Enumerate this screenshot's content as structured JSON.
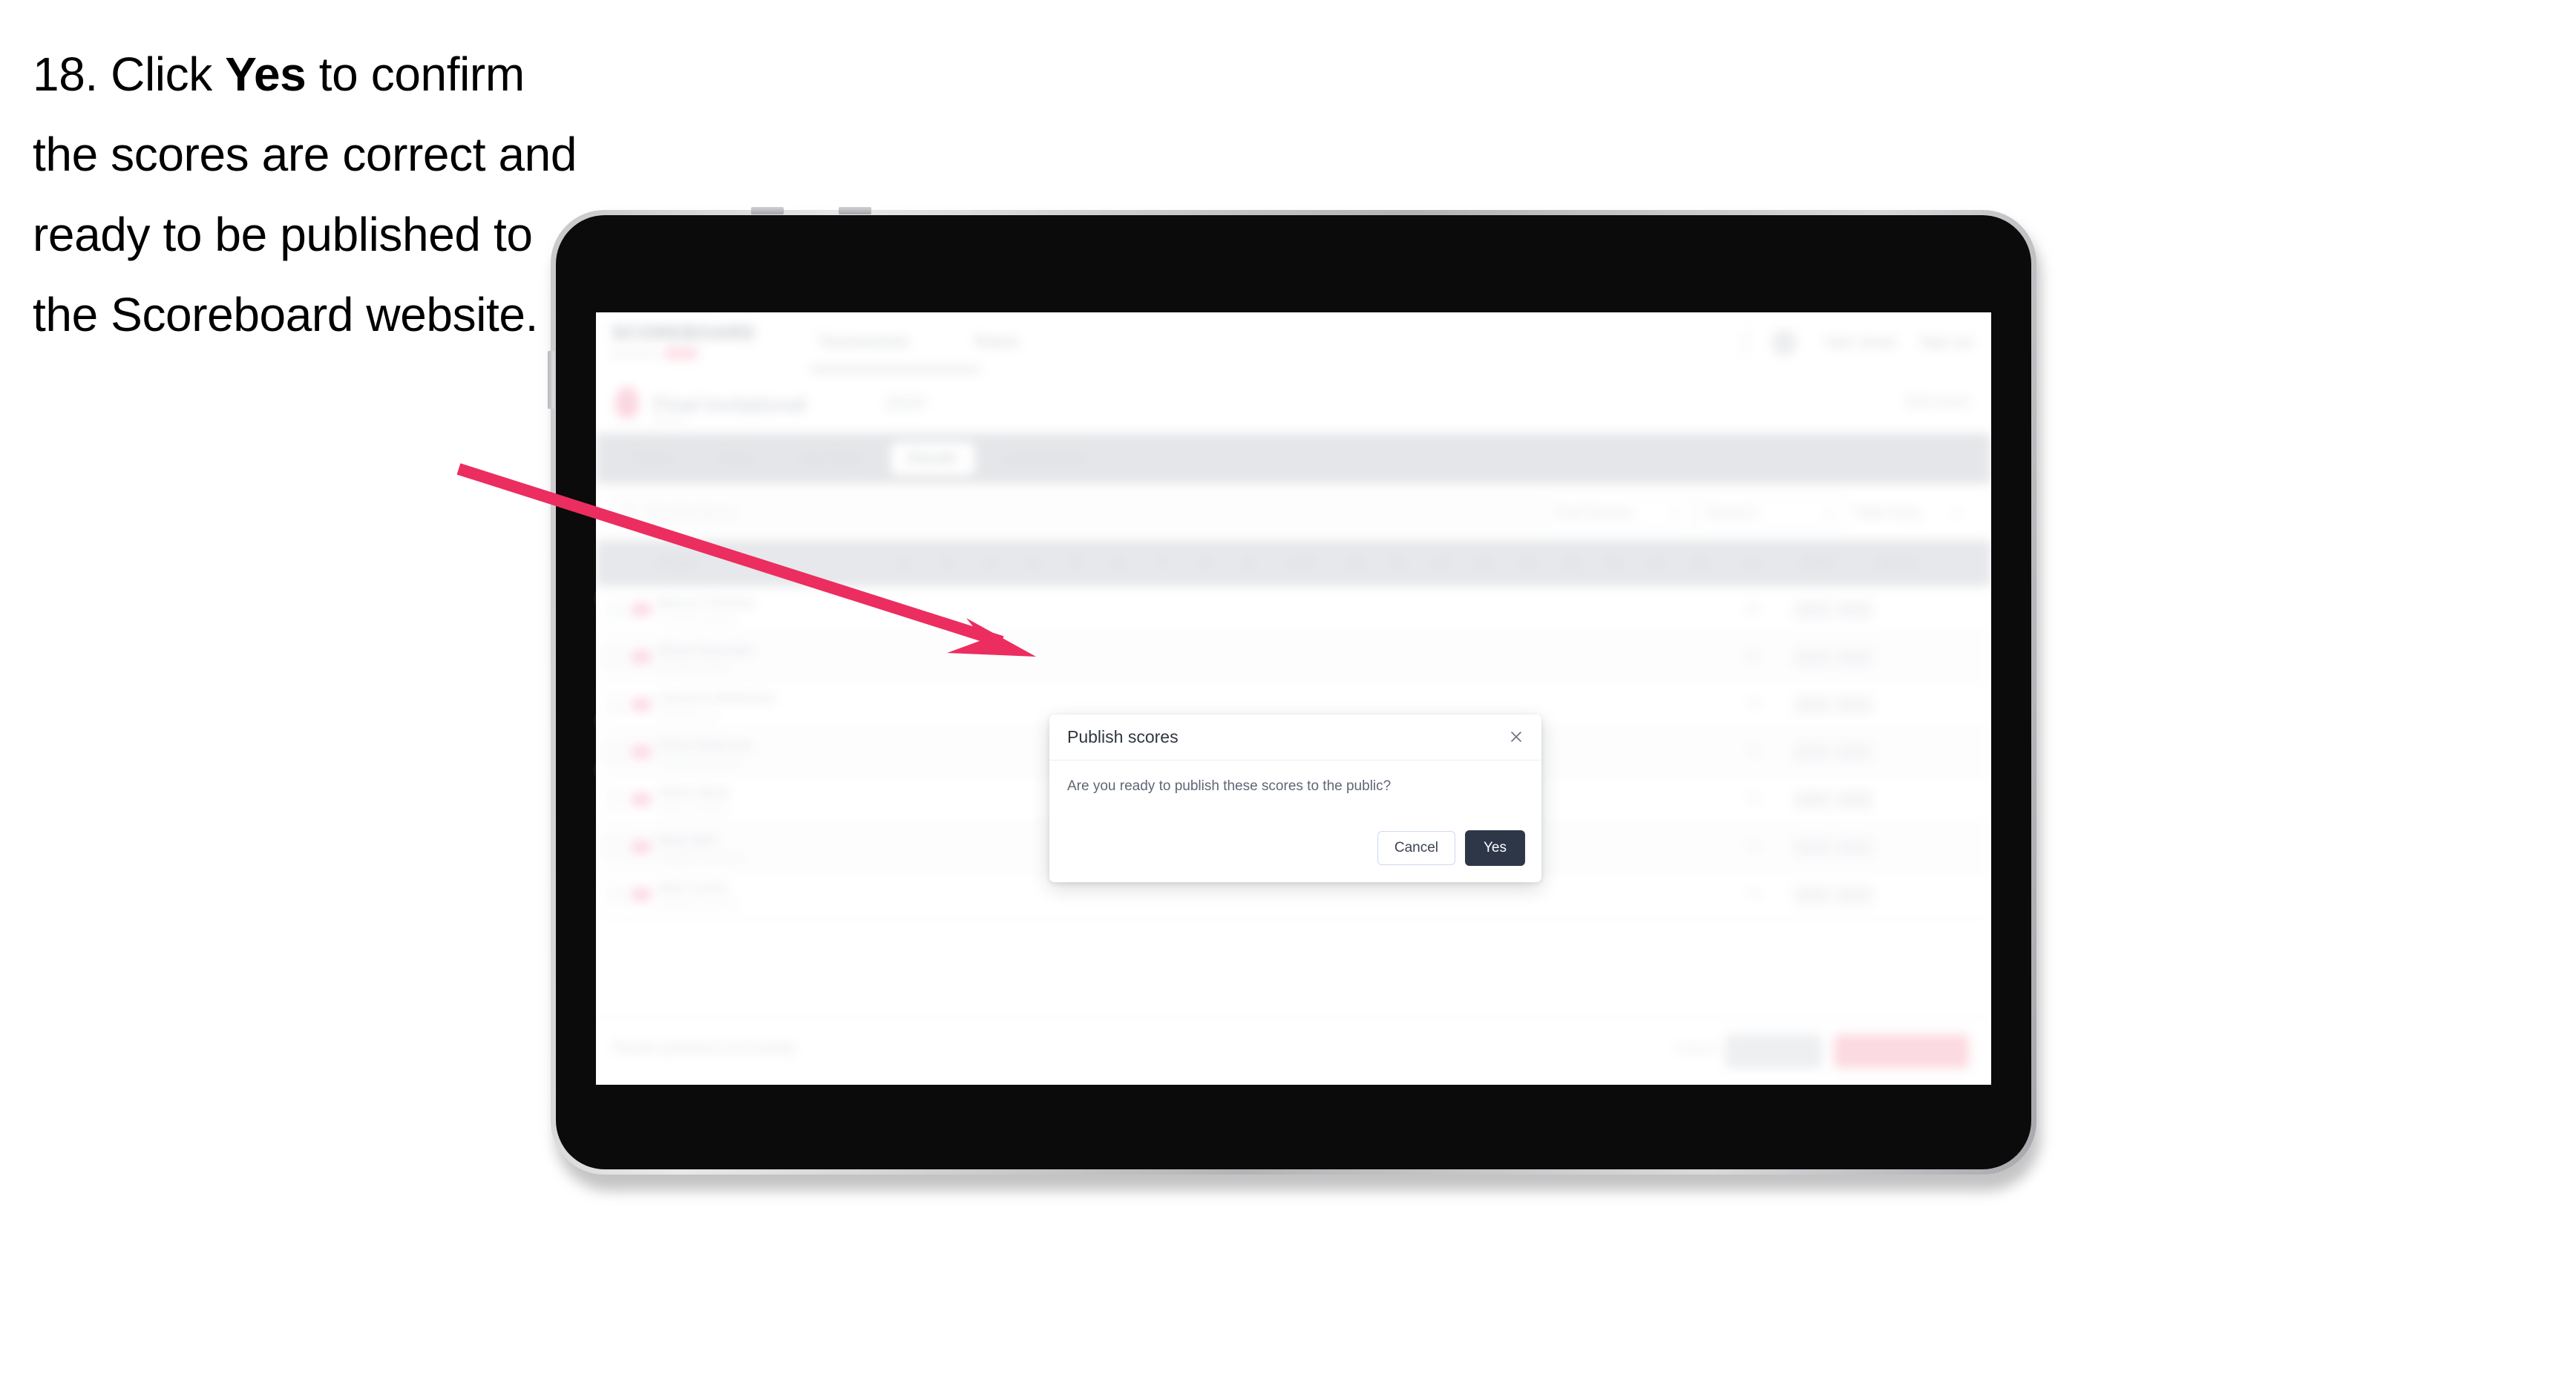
{
  "instruction": {
    "number": "18.",
    "before_bold": "Click ",
    "bold": "Yes",
    "after_bold": " to confirm the scores are correct and ready to be published to the Scoreboard website."
  },
  "annotation": {
    "arrow_color": "#EC2D5F",
    "points_to": "modal-yes-button"
  },
  "app": {
    "brand": {
      "wordmark": "SCOREBOARD",
      "subtext": "powered by",
      "pill_label": "BETA"
    },
    "topnav": {
      "links": [
        "Tournaments",
        "Teams"
      ],
      "user_name": "Sam Jones",
      "signout_label": "Sign out"
    },
    "event": {
      "title": "Final Invitational",
      "tag": "2024",
      "meta": "Round 1",
      "right_label": "Edit event"
    },
    "tabs": [
      {
        "label": "Teams",
        "active": false
      },
      {
        "label": "Draw",
        "active": false
      },
      {
        "label": "Live Entry",
        "active": false
      },
      {
        "label": "Results",
        "active": true
      },
      {
        "label": "Leaderboard",
        "active": false
      }
    ],
    "filters": {
      "search_placeholder": "Search players",
      "controls": [
        {
          "label": "Final Session"
        },
        {
          "label": "Round 1"
        },
        {
          "label": "Table Entry"
        }
      ]
    },
    "table": {
      "columns": [
        "Player",
        "1",
        "2",
        "3",
        "4",
        "5",
        "6",
        "7",
        "8",
        "9",
        "Out",
        "10",
        "11",
        "12",
        "13",
        "14",
        "15",
        "16",
        "17",
        "18",
        "In",
        "Total",
        "Status"
      ],
      "rows": [
        {
          "name": "Marcus Thomas",
          "sub": "Crestview Academy",
          "total": "68",
          "net": "70"
        },
        {
          "name": "Ethan Reynolds",
          "sub": "Lakeside College",
          "total": "69",
          "net": "71"
        },
        {
          "name": "Cameron Robinson",
          "sub": "Northside Prep",
          "total": "70",
          "net": "72"
        },
        {
          "name": "Chris Patterson",
          "sub": "Riverbend University",
          "total": "71",
          "net": "73"
        },
        {
          "name": "Oliver Ward",
          "sub": "Hillcrest Academy",
          "total": "72",
          "net": "74"
        },
        {
          "name": "Ryan Bell",
          "sub": "Westfield Community",
          "total": "73",
          "net": "75"
        },
        {
          "name": "Nate Foster",
          "sub": "Oakridge University",
          "total": "74",
          "net": "76"
        }
      ]
    },
    "footer": {
      "note": "Results published successfully",
      "link_label": "Cancel",
      "secondary_button": "Save all",
      "primary_button": "Publish to Scoreboard"
    }
  },
  "modal": {
    "title": "Publish scores",
    "message": "Are you ready to publish these scores to the public?",
    "cancel_label": "Cancel",
    "confirm_label": "Yes",
    "close_icon": "close-icon",
    "confirm_color": "#2D3748"
  }
}
